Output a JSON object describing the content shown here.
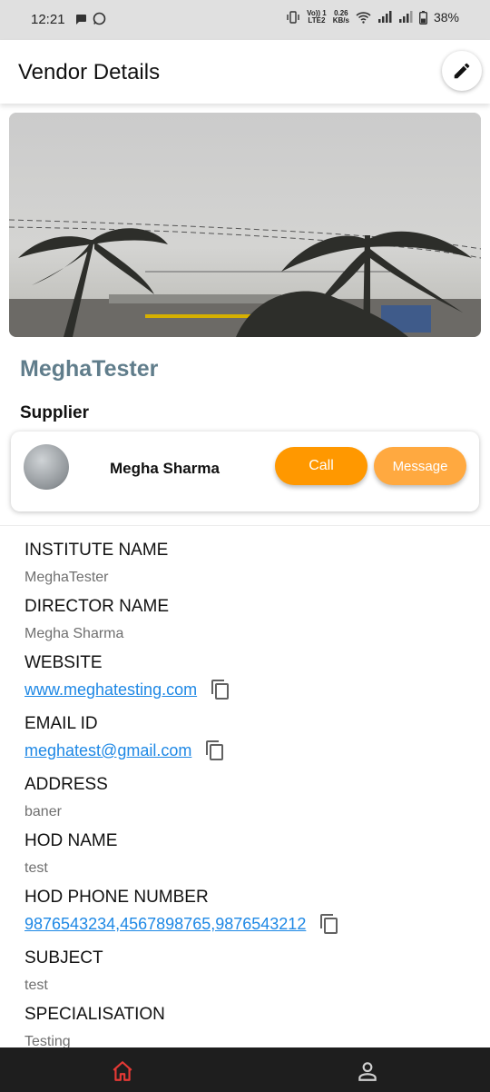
{
  "status_bar": {
    "time": "12:21",
    "net_top": "Vo)) 1",
    "net_bottom": "LTE2",
    "speed_top": "0.26",
    "speed_bottom": "KB/s",
    "battery": "38%"
  },
  "app_bar": {
    "title": "Vendor Details"
  },
  "organization": {
    "name": "MeghaTester"
  },
  "supplier_section": {
    "label": "Supplier",
    "name": "Megha Sharma",
    "call_label": "Call",
    "message_label": "Message"
  },
  "details": [
    {
      "label": "INSTITUTE NAME",
      "value": "MeghaTester"
    },
    {
      "label": "DIRECTOR NAME",
      "value": "Megha Sharma"
    },
    {
      "label": "WEBSITE",
      "value": "www.meghatesting.com"
    },
    {
      "label": "EMAIL ID",
      "value": "meghatest@gmail.com"
    },
    {
      "label": "ADDRESS",
      "value": "baner"
    },
    {
      "label": "HOD NAME",
      "value": "test"
    },
    {
      "label": "HOD PHONE NUMBER",
      "value": "9876543234,4567898765,9876543212"
    },
    {
      "label": "SUBJECT",
      "value": "test"
    },
    {
      "label": "SPECIALISATION",
      "value": "Testing"
    }
  ],
  "colors": {
    "accent_orange": "#ff9800",
    "message_orange": "#ffa940",
    "link_blue": "#1e88e5",
    "org_name": "#607d8b",
    "nav_active": "#e53935",
    "nav_bg": "#1e1e1e"
  },
  "icons": {
    "edit": "pencil-icon",
    "copy": "copy-icon",
    "home": "home-icon",
    "profile": "profile-icon"
  }
}
